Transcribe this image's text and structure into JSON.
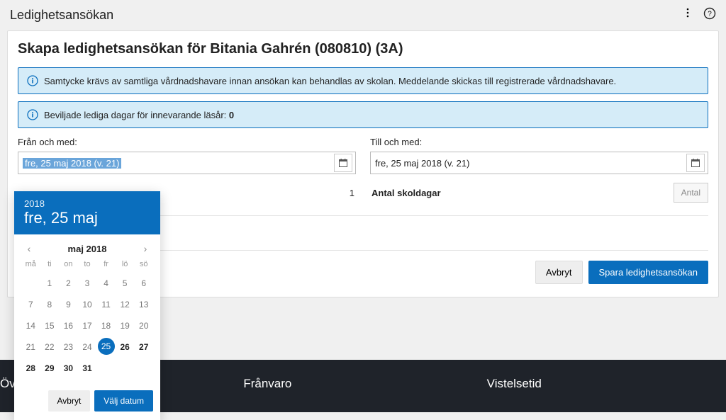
{
  "topbar": {
    "title": "Ledighetsansökan"
  },
  "card": {
    "title": "Skapa ledighetsansökan för Bitania Gahrén (080810) (3A)",
    "info1": "Samtycke krävs av samtliga vårdnadshavare innan ansökan kan behandlas av skolan. Meddelande skickas till registrerade vårdnadshavare.",
    "info2_prefix": "Beviljade lediga dagar för innevarande läsår: ",
    "info2_value": "0",
    "from_label": "Från och med:",
    "from_value": "fre, 25 maj 2018 (v. 21)",
    "to_label": "Till och med:",
    "to_value": "fre, 25 maj 2018 (v. 21)",
    "days_value": "1",
    "schooldays_label": "Antal skoldagar",
    "antal_placeholder": "Antal",
    "cancel": "Avbryt",
    "save": "Spara ledighetsansökan"
  },
  "datepicker": {
    "year": "2018",
    "title_date": "fre, 25 maj",
    "month_label": "maj 2018",
    "dow": [
      "må",
      "ti",
      "on",
      "to",
      "fr",
      "lö",
      "sö"
    ],
    "days_prev_blank": [
      "",
      "1",
      "2",
      "3",
      "4",
      "5",
      "6"
    ],
    "weeks": [
      [
        "7",
        "8",
        "9",
        "10",
        "11",
        "12",
        "13"
      ],
      [
        "14",
        "15",
        "16",
        "17",
        "18",
        "19",
        "20"
      ],
      [
        "21",
        "22",
        "23",
        "24",
        "25",
        "26",
        "27"
      ],
      [
        "28",
        "29",
        "30",
        "31",
        "",
        "",
        ""
      ]
    ],
    "selected": "25",
    "cancel": "Avbryt",
    "choose": "Välj datum"
  },
  "footer": {
    "col1": "Öv",
    "col2": "Frånvaro",
    "col3": "Vistelsetid"
  }
}
